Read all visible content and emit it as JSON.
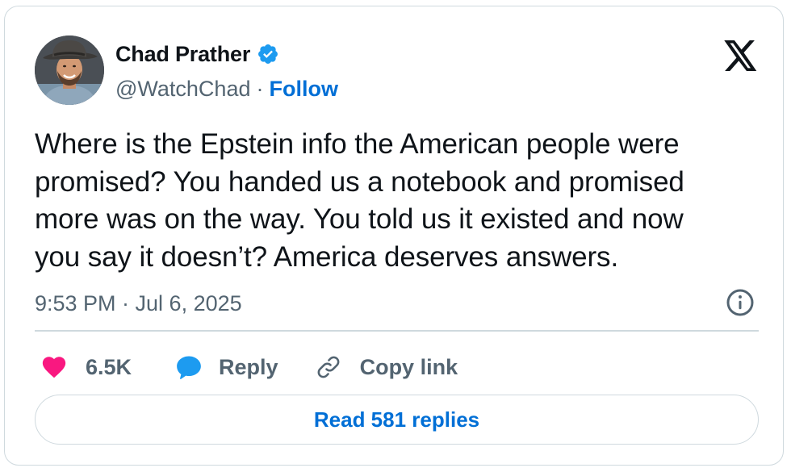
{
  "author": {
    "name": "Chad Prather",
    "handle": "@WatchChad",
    "separator": "·",
    "follow_label": "Follow",
    "verified": true
  },
  "tweet": {
    "text": "Where is the Epstein info the American people were\npromised? You handed us a notebook and promised\nmore was on the way. You told us it existed and now\nyou say it doesn’t? America deserves answers.",
    "timestamp": "9:53 PM · Jul 6, 2025"
  },
  "actions": {
    "like_count": "6.5K",
    "reply_label": "Reply",
    "copy_label": "Copy link"
  },
  "read_replies_label": "Read 581 replies",
  "icons": {
    "avatar": "profile-photo",
    "verified": "verified-badge-icon",
    "platform": "x-logo-icon",
    "info": "info-icon",
    "like": "heart-icon",
    "reply": "speech-bubble-icon",
    "copy": "link-icon"
  },
  "colors": {
    "text": "#0f1419",
    "secondary": "#536471",
    "link": "#006fd6",
    "verified": "#1d9bf0",
    "like": "#f91880",
    "reply": "#1d9bf0",
    "border": "#cfd9de"
  }
}
